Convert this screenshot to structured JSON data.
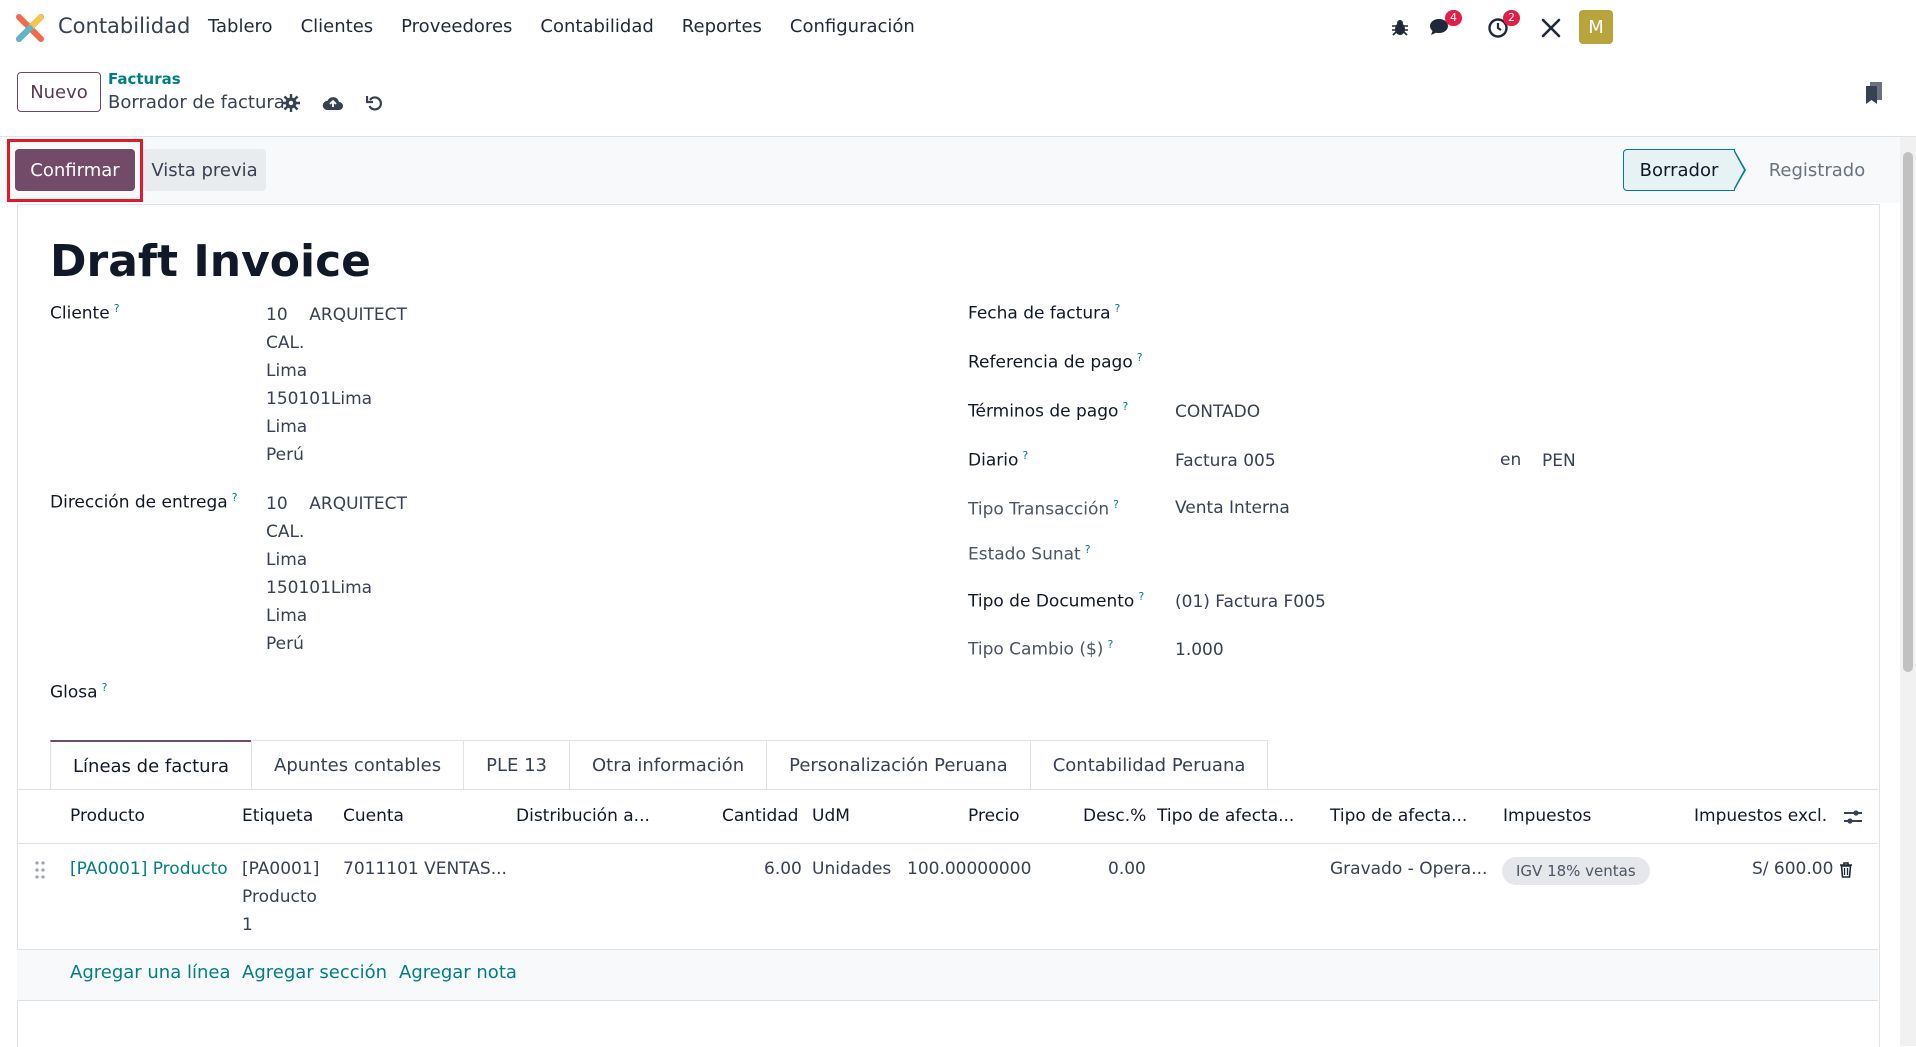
{
  "navbar": {
    "app_name": "Contabilidad",
    "menu": [
      "Tablero",
      "Clientes",
      "Proveedores",
      "Contabilidad",
      "Reportes",
      "Configuración"
    ],
    "messages_count": "4",
    "activities_count": "2",
    "avatar_initial": "M"
  },
  "control": {
    "new_label": "Nuevo",
    "breadcrumb_parent": "Facturas",
    "breadcrumb_current": "Borrador de factura"
  },
  "status": {
    "confirm_label": "Confirmar",
    "preview_label": "Vista previa",
    "stages": [
      "Borrador",
      "Registrado"
    ],
    "active_stage": "Borrador"
  },
  "form": {
    "title": "Draft Invoice",
    "cliente_label": "Cliente",
    "cliente_lines": [
      "10",
      "ARQUITECT",
      "CAL.",
      "Lima",
      "150101Lima",
      "Lima",
      "Perú"
    ],
    "entrega_label": "Dirección de entrega",
    "entrega_lines": [
      "10",
      "ARQUITECT",
      "CAL.",
      "Lima",
      "150101Lima",
      "Lima",
      "Perú"
    ],
    "glosa_label": "Glosa",
    "fecha_label": "Fecha de factura",
    "referencia_label": "Referencia de pago",
    "terminos_label": "Términos de pago",
    "terminos_value": "CONTADO",
    "diario_label": "Diario",
    "diario_value": "Factura 005",
    "currency_prefix": "en",
    "currency_value": "PEN",
    "tipo_transaccion_label": "Tipo Transacción",
    "tipo_transaccion_value": "Venta Interna",
    "estado_sunat_label": "Estado Sunat",
    "tipo_documento_label": "Tipo de Documento",
    "tipo_documento_value": "(01) Factura F005",
    "tipo_cambio_label": "Tipo Cambio ($)",
    "tipo_cambio_value": "1.000",
    "help_mark": "?"
  },
  "tabs": [
    "Líneas de factura",
    "Apuntes contables",
    "PLE 13",
    "Otra información",
    "Personalización Peruana",
    "Contabilidad Peruana"
  ],
  "table": {
    "columns": [
      "Producto",
      "Etiqueta",
      "Cuenta",
      "Distribución a...",
      "Cantidad",
      "UdM",
      "Precio",
      "Desc.%",
      "Tipo de afecta...",
      "Tipo de afecta...",
      "Impuestos",
      "Impuestos excl."
    ],
    "rows": [
      {
        "producto": "[PA0001] Producto 1",
        "etiqueta_lines": [
          "[PA0001]",
          "Producto",
          "1"
        ],
        "cuenta": "7011101 VENTAS...",
        "distribucion": "",
        "cantidad": "6.00",
        "udm": "Unidades",
        "precio": "100.00000000",
        "descuento": "0.00",
        "tipo_afectacion_1": "",
        "tipo_afectacion_2": "Gravado - Opera...",
        "impuestos": "IGV 18% ventas",
        "subtotal": "S/ 600.00"
      }
    ],
    "add_line": "Agregar una línea",
    "add_section": "Agregar sección",
    "add_note": "Agregar nota"
  },
  "colors": {
    "brand": "#714b67",
    "link": "#017e84",
    "highlight": "#e0192c"
  }
}
